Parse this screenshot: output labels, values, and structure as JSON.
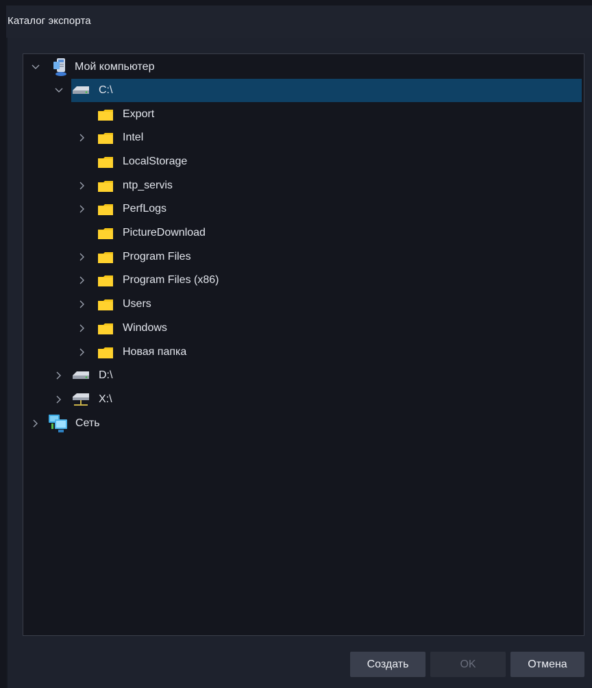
{
  "dialog": {
    "title": "Каталог экспорта",
    "accent_color": "#0f4165"
  },
  "tree": {
    "root": {
      "label": "Мой компьютер",
      "icon": "computer-icon",
      "expanded": true
    },
    "drive_c": {
      "label": "C:\\",
      "icon": "drive-icon",
      "expanded": true,
      "selected": true
    },
    "folders": [
      {
        "label": "Export",
        "has_children": false
      },
      {
        "label": "Intel",
        "has_children": true
      },
      {
        "label": "LocalStorage",
        "has_children": false
      },
      {
        "label": "ntp_servis",
        "has_children": true
      },
      {
        "label": "PerfLogs",
        "has_children": true
      },
      {
        "label": "PictureDownload",
        "has_children": false
      },
      {
        "label": "Program Files",
        "has_children": true
      },
      {
        "label": "Program Files (x86)",
        "has_children": true
      },
      {
        "label": "Users",
        "has_children": true
      },
      {
        "label": "Windows",
        "has_children": true
      },
      {
        "label": "Новая папка",
        "has_children": true
      }
    ],
    "drive_d": {
      "label": "D:\\",
      "icon": "drive-icon",
      "expanded": false
    },
    "drive_x": {
      "label": "X:\\",
      "icon": "network-drive-icon",
      "expanded": false
    },
    "network": {
      "label": "Сеть",
      "icon": "network-icon",
      "expanded": false
    }
  },
  "buttons": {
    "create": "Создать",
    "ok": "OK",
    "cancel": "Отмена"
  }
}
